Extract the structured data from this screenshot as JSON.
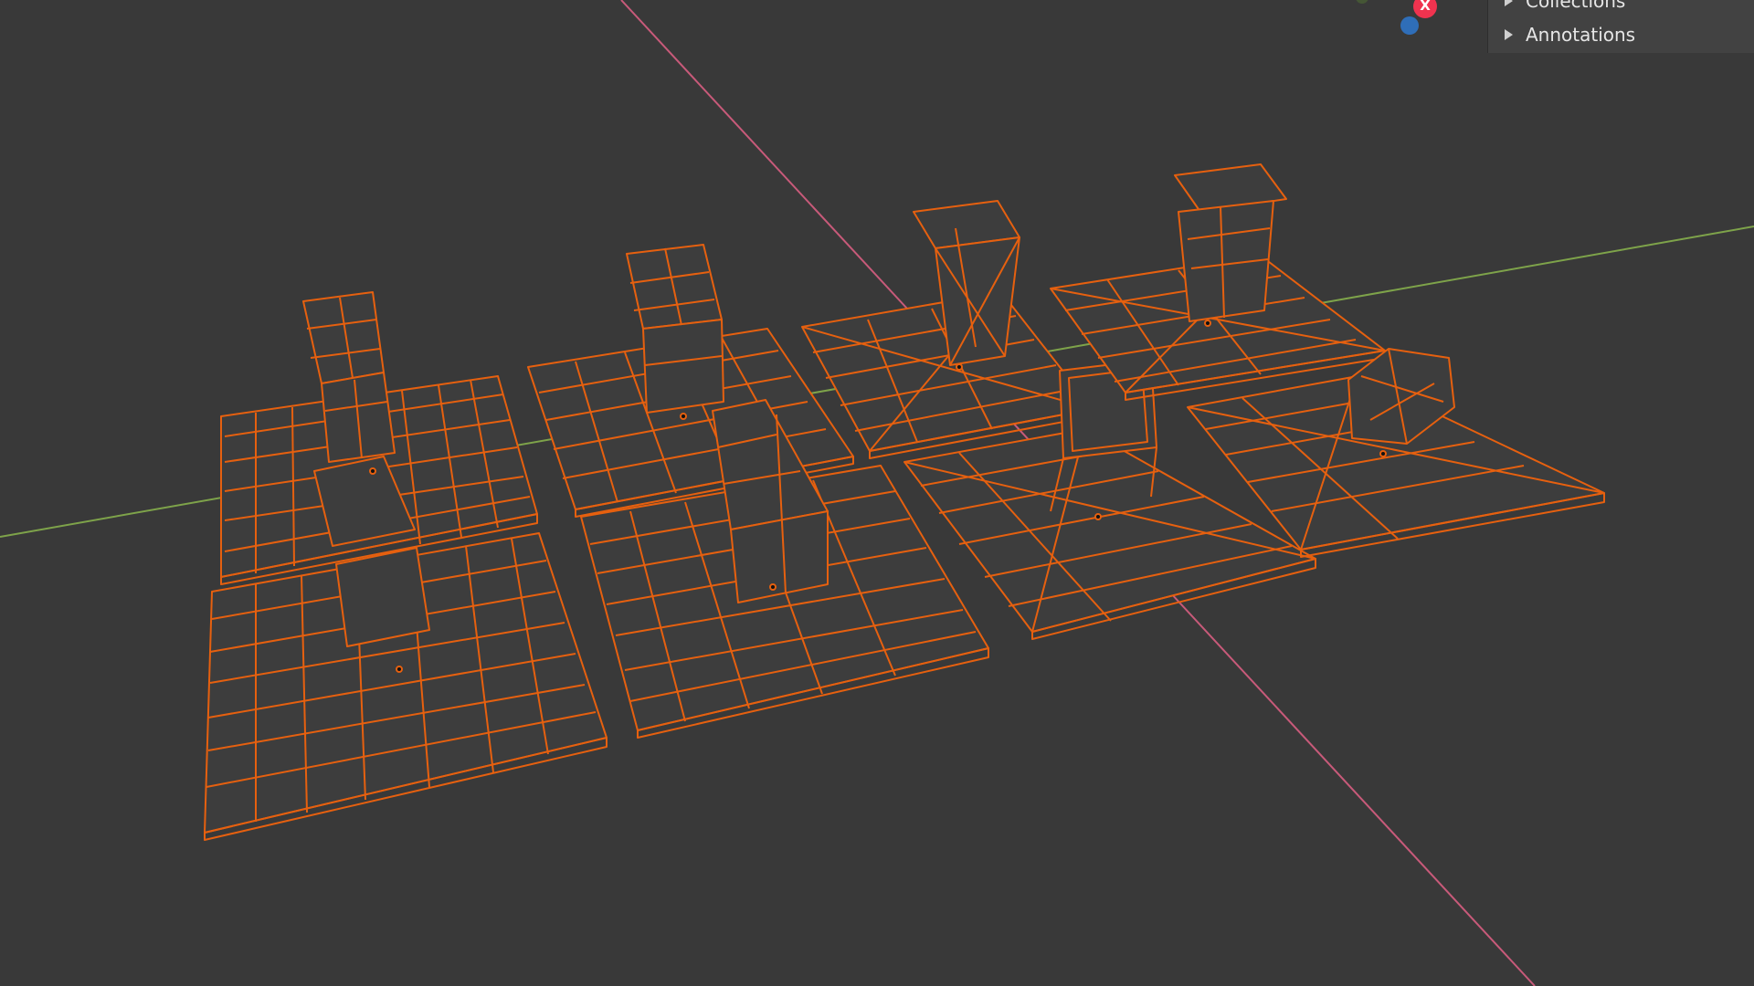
{
  "outliner": {
    "items": [
      {
        "label": "Collections",
        "icon": "triangle-right-icon"
      },
      {
        "label": "Annotations",
        "icon": "triangle-right-icon"
      }
    ]
  },
  "gizmo": {
    "x_label": "X"
  },
  "colors": {
    "background": "#393939",
    "wireframe": "#e6600f",
    "x_axis": "#c85a7a",
    "y_axis": "#7ea34a",
    "gizmo_x": "#f0334f",
    "gizmo_z": "#2f6eb8"
  }
}
